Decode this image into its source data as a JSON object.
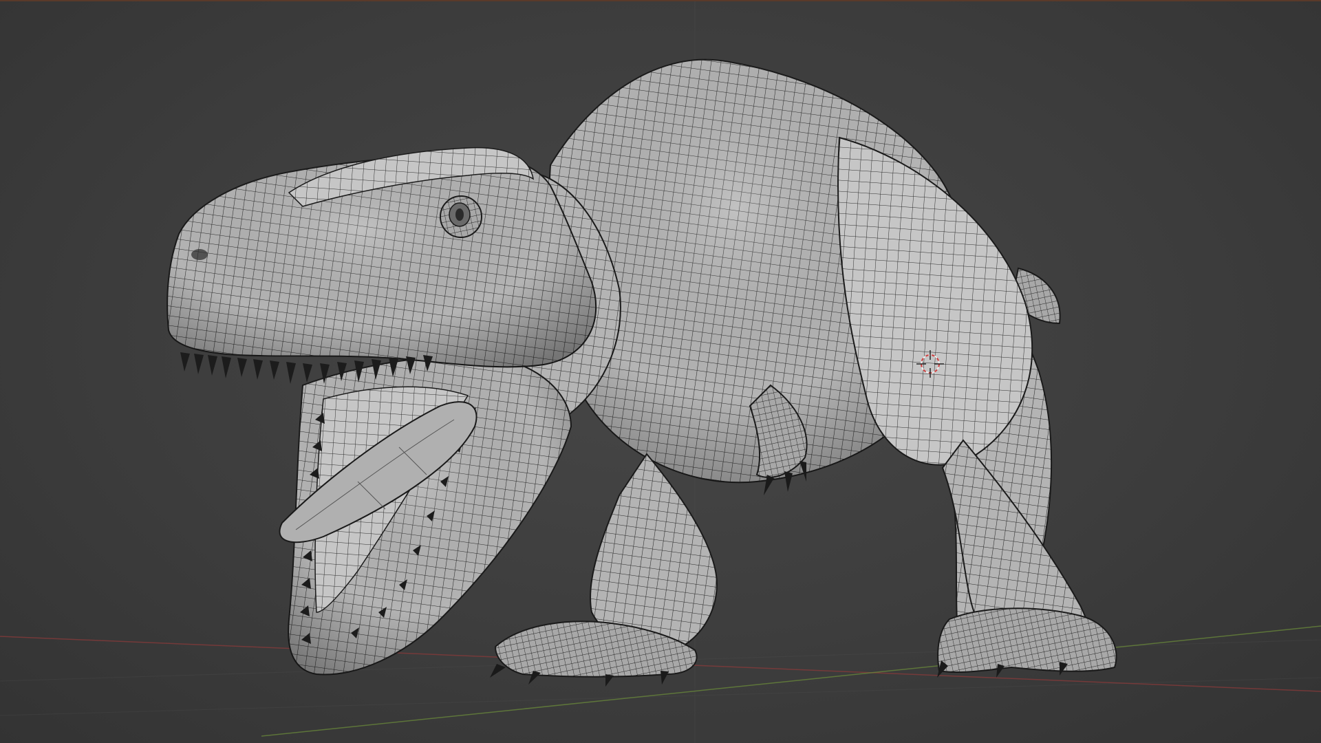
{
  "app": {
    "name": "3D Viewport",
    "shading_mode": "wireframe-over-solid"
  },
  "scene": {
    "object": "t-rex-mesh",
    "mesh_color": "#b8b8b8",
    "wire_color": "#1c1c1c",
    "background_color": "#3d3d3d",
    "axis_x_color": "#8a3a3a",
    "axis_y_color": "#6a8a3a",
    "cursor_color": "#d04040"
  }
}
